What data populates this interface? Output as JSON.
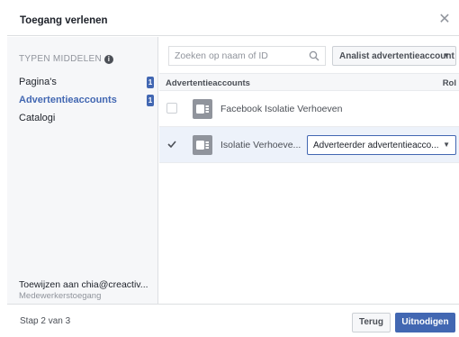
{
  "dialog": {
    "title": "Toegang verlenen",
    "close_icon": "close-icon"
  },
  "sidebar": {
    "types_heading": "TYPEN MIDDELEN",
    "info_icon": "info-icon",
    "items": [
      {
        "label": "Pagina's",
        "badge": "1"
      },
      {
        "label": "Advertentieaccounts",
        "badge": "1",
        "active": true
      },
      {
        "label": "Catalogi",
        "badge": ""
      }
    ],
    "assign_line1": "Toewijzen aan chia@creactiv...",
    "assign_line2": "Medewerkerstoegang"
  },
  "main": {
    "search_placeholder": "Zoeken op naam of ID",
    "role_select": "Analist advertentieaccount",
    "table": {
      "col_accounts": "Advertentieaccounts",
      "col_role": "Rol"
    },
    "rows": [
      {
        "name": "Facebook Isolatie Verhoeven",
        "checked": false,
        "role": ""
      },
      {
        "name": "Isolatie Verhoeve...",
        "checked": true,
        "role": "Adverteerder advertentieacco..."
      }
    ]
  },
  "footer": {
    "step": "Stap 2 van 3",
    "back_label": "Terug",
    "invite_label": "Uitnodigen"
  },
  "colors": {
    "accent": "#4267b2",
    "selected_row": "#edf2fa",
    "sidebar_bg": "#f6f7f9"
  }
}
